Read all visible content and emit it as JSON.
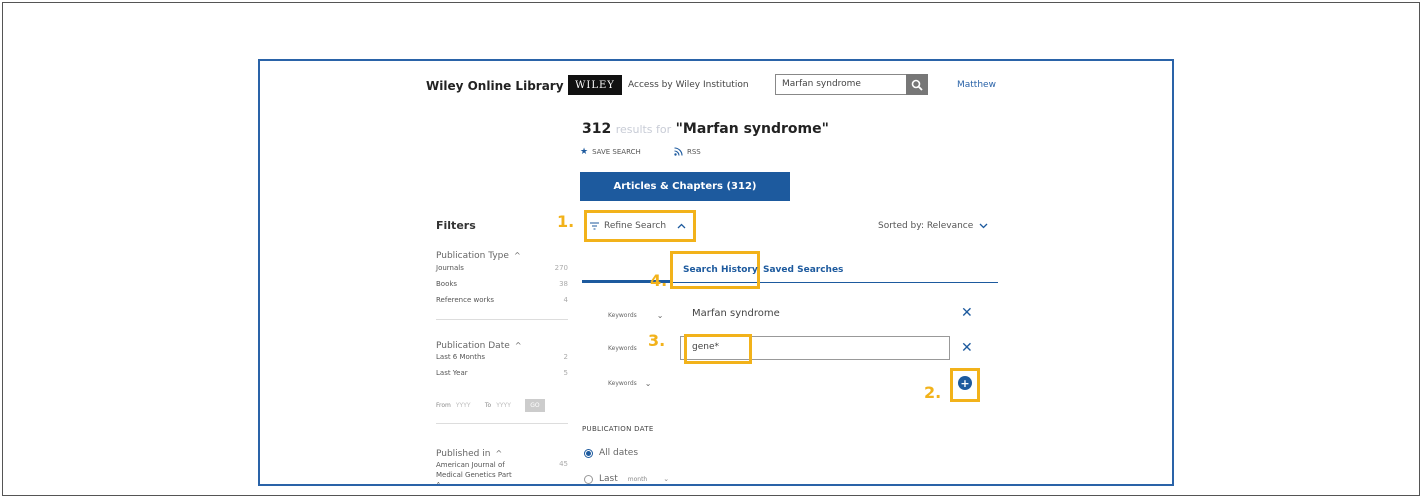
{
  "header": {
    "brand": "Wiley Online Library",
    "logo": "WILEY",
    "access": "Access by Wiley Institution",
    "search_value": "Marfan syndrome",
    "user": "Matthew"
  },
  "results": {
    "count": "312",
    "label": "results for",
    "query": "\"Marfan syndrome\"",
    "save_search": "SAVE SEARCH",
    "rss": "RSS"
  },
  "tabs": {
    "articles": "Articles & Chapters (312)"
  },
  "filters": {
    "title": "Filters",
    "publication_type": {
      "label": "Publication Type",
      "items": [
        {
          "label": "Journals",
          "count": "270"
        },
        {
          "label": "Books",
          "count": "38"
        },
        {
          "label": "Reference works",
          "count": "4"
        }
      ]
    },
    "publication_date": {
      "label": "Publication Date",
      "items": [
        {
          "label": "Last 6 Months",
          "count": "2"
        },
        {
          "label": "Last Year",
          "count": "5"
        }
      ],
      "from_label": "From",
      "from_value": "YYYY",
      "to_label": "To",
      "to_value": "YYYY",
      "go": "GO"
    },
    "published_in": {
      "label": "Published in",
      "items": [
        {
          "label": "American Journal of Medical Genetics Part A",
          "count": "45"
        }
      ]
    }
  },
  "refine": {
    "label": "Refine Search",
    "sorted": "Sorted by: Relevance",
    "tabs": {
      "history": "Search History",
      "saved": "Saved Searches"
    },
    "rows": [
      {
        "field": "Keywords",
        "value": "Marfan syndrome"
      },
      {
        "field": "Keywords",
        "value": "gene*"
      },
      {
        "field": "Keywords",
        "value": ""
      }
    ],
    "pubdate_title": "PUBLICATION DATE",
    "all_dates": "All dates",
    "last": "Last",
    "last_unit": "month"
  },
  "annotations": [
    "1.",
    "2.",
    "3.",
    "4."
  ],
  "colors": {
    "highlight": "#f2b21a",
    "brand_blue": "#1d5a9e",
    "frame": "#2a63a8"
  }
}
